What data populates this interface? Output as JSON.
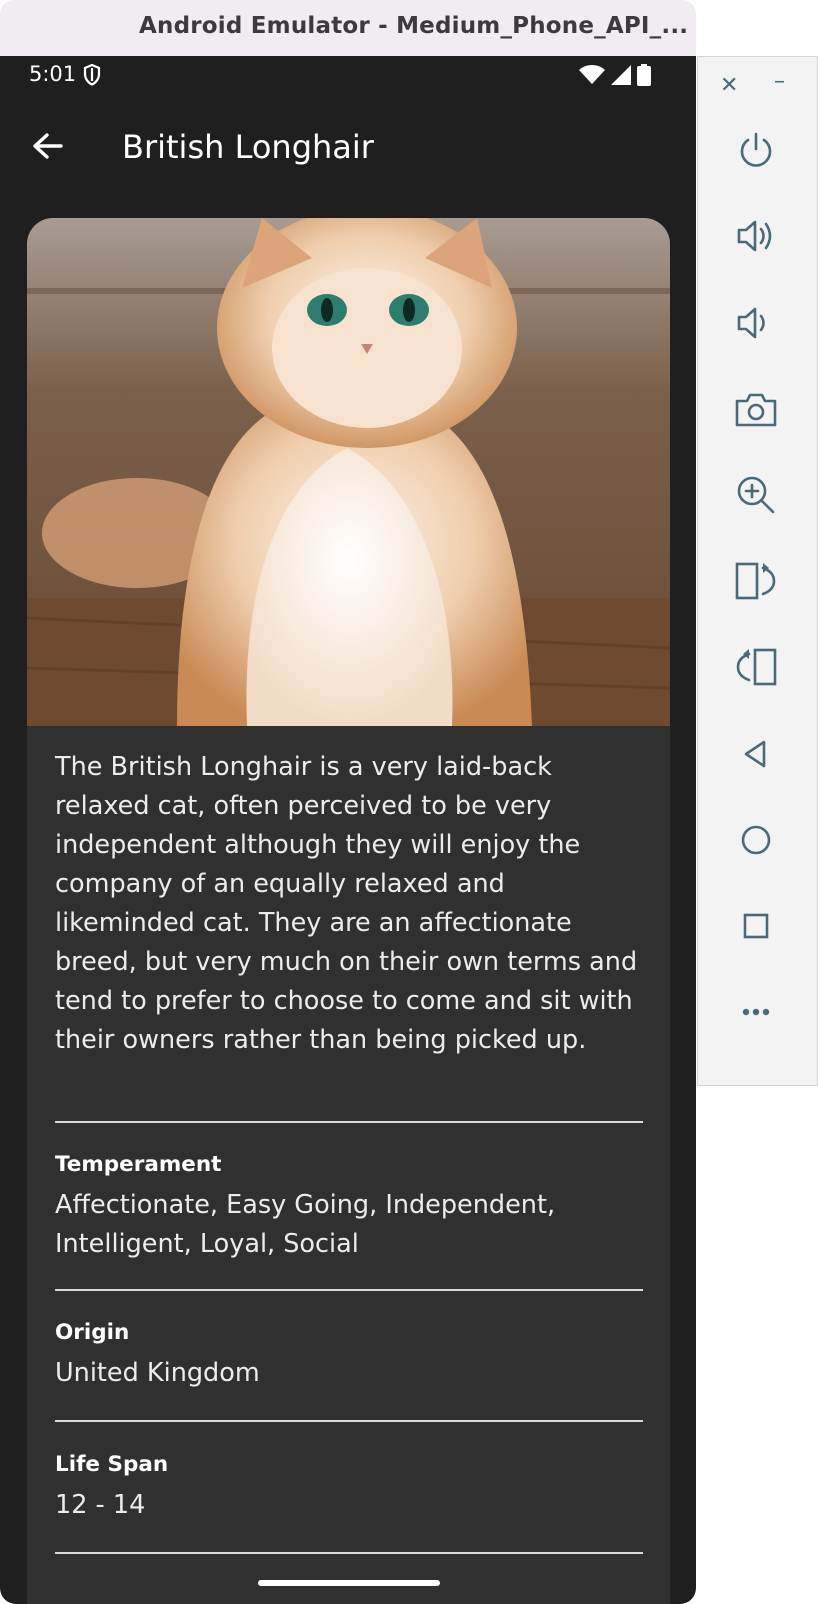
{
  "window": {
    "title": "Android Emulator - Medium_Phone_API_..."
  },
  "status_bar": {
    "time": "5:01",
    "icons": [
      "shield-icon",
      "wifi-icon",
      "signal-icon",
      "battery-icon"
    ]
  },
  "app_bar": {
    "title": "British Longhair",
    "back_icon": "arrow-back-icon"
  },
  "breed": {
    "image_subject": "cream-colored longhair cat",
    "description": "The British Longhair is a very laid-back relaxed cat, often perceived to be very independent although they will enjoy the company of an equally relaxed and likeminded cat. They are an affectionate breed, but very much on their own terms and tend to prefer to choose to come and sit with their owners rather than being picked up.",
    "fields": [
      {
        "label": "Temperament",
        "value": "Affectionate, Easy Going, Independent, Intelligent, Loyal, Social"
      },
      {
        "label": "Origin",
        "value": "United Kingdom"
      },
      {
        "label": "Life Span",
        "value": "12 - 14"
      }
    ]
  },
  "emulator_toolbar": {
    "items": [
      "close-icon",
      "minimize-icon",
      "power-icon",
      "volume-up-icon",
      "volume-down-icon",
      "camera-icon",
      "zoom-in-icon",
      "rotate-left-icon",
      "rotate-right-icon",
      "back-icon",
      "home-icon",
      "overview-icon",
      "more-icon"
    ]
  },
  "colors": {
    "phone_bg": "#1f1f1f",
    "card_bg": "#303030",
    "toolbar_icon": "#4a6a7a",
    "title_tab_bg": "#f1ebf2"
  }
}
